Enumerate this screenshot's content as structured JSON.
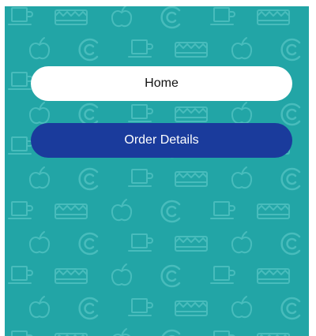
{
  "colors": {
    "panel_background": "#22a5a6",
    "pattern_stroke": "#48bcbc",
    "home_button_bg": "#ffffff",
    "home_button_text": "#111111",
    "order_button_bg": "#1a3b9c",
    "order_button_text": "#ffffff"
  },
  "background_pattern": {
    "icons": [
      "cup-icon",
      "cake-icon",
      "apple-icon",
      "c-logo-icon"
    ]
  },
  "buttons": {
    "home_label": "Home",
    "order_details_label": "Order Details"
  }
}
